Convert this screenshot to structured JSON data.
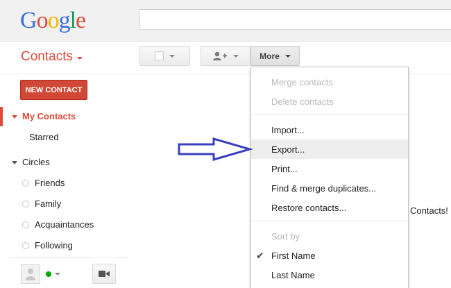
{
  "logo": {
    "letters": [
      {
        "ch": "G",
        "color": "#3b6fd5"
      },
      {
        "ch": "o",
        "color": "#dd4b39"
      },
      {
        "ch": "o",
        "color": "#f4b400"
      },
      {
        "ch": "g",
        "color": "#3b6fd5"
      },
      {
        "ch": "l",
        "color": "#0f9d58"
      },
      {
        "ch": "e",
        "color": "#dd4b39"
      }
    ]
  },
  "search": {
    "value": "",
    "placeholder": ""
  },
  "header": {
    "app_title": "Contacts",
    "more_label": "More"
  },
  "sidebar": {
    "new_contact_label": "NEW CONTACT",
    "my_contacts": "My Contacts",
    "starred": "Starred",
    "circles_header": "Circles",
    "circles": [
      "Friends",
      "Family",
      "Acquaintances",
      "Following"
    ]
  },
  "menu": {
    "merge_contacts": "Merge contacts",
    "delete_contacts": "Delete contacts",
    "import": "Import...",
    "export": "Export...",
    "print": "Print...",
    "find_merge": "Find & merge duplicates...",
    "restore": "Restore contacts...",
    "sort_by": "Sort by",
    "first_name": "First Name",
    "last_name": "Last Name"
  },
  "main": {
    "partial_text": "Contacts!"
  },
  "colors": {
    "accent_red": "#dd4b39",
    "arrow_blue": "#3a3fbf"
  }
}
